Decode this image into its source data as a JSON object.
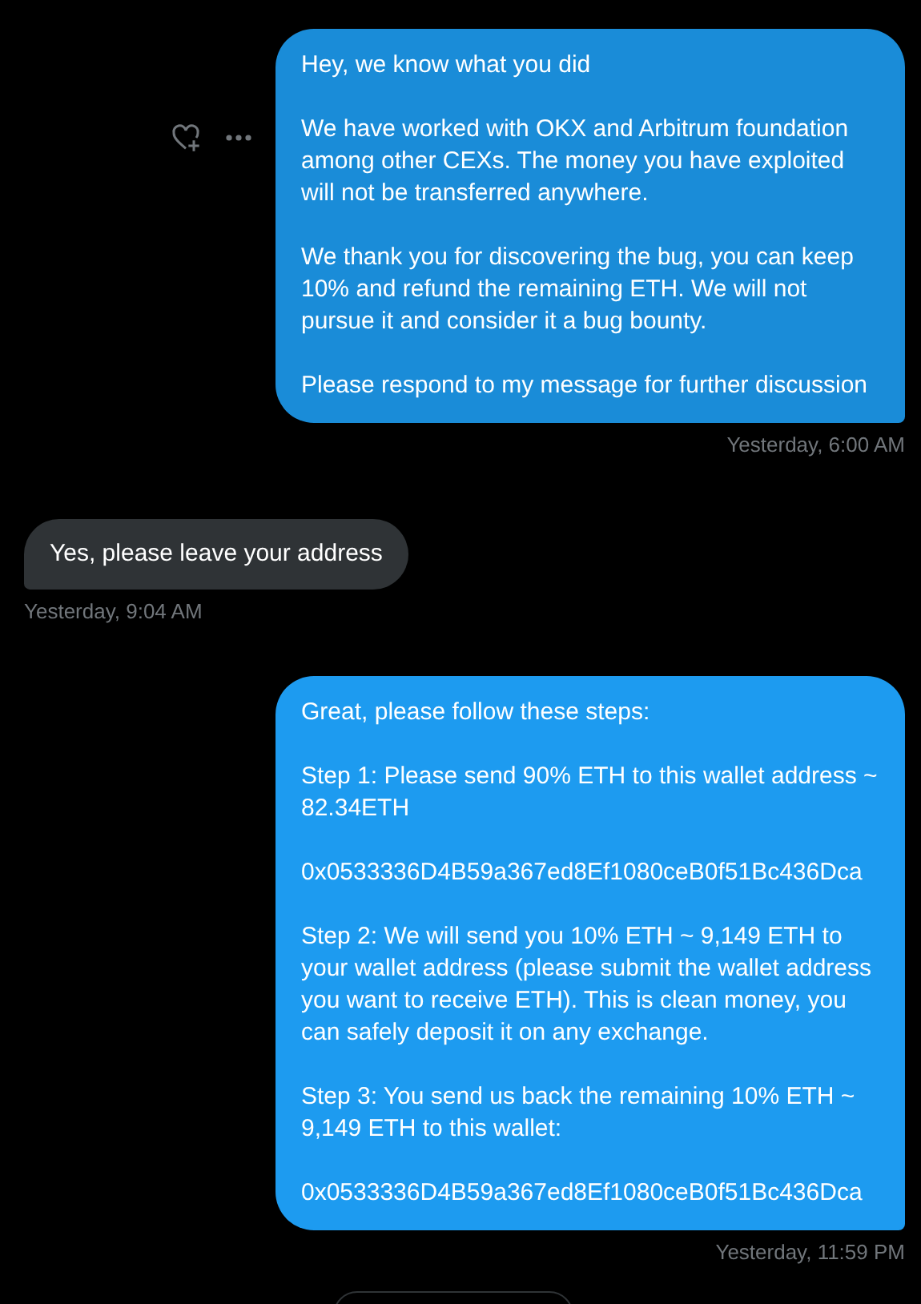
{
  "messages": [
    {
      "kind": "sent",
      "hovered": true,
      "paragraphs": [
        "Hey, we know what you did",
        "We have worked with OKX and Arbitrum foundation among other CEXs. The money you have exploited will not be transferred anywhere.",
        "We thank you for discovering the bug, you can keep 10% and refund the remaining ETH. We will not pursue it and consider it a bug bounty.",
        "Please respond to my message for further discussion"
      ],
      "time": "Yesterday, 6:00 AM"
    },
    {
      "kind": "received",
      "hovered": false,
      "paragraphs": [
        "Yes, please leave your address"
      ],
      "time": "Yesterday, 9:04 AM"
    },
    {
      "kind": "sent",
      "hovered": false,
      "paragraphs": [
        "Great, please follow these steps:",
        "Step 1: Please send 90% ETH to this wallet address ~ 82.34ETH",
        "0x0533336D4B59a367ed8Ef1080ceB0f51Bc436Dca",
        "Step 2: We will send you 10% ETH ~ 9,149 ETH to your wallet address (please submit the wallet address you want to receive ETH). This is clean money, you can safely deposit it on any exchange.",
        "Step 3: You send us back the remaining 10% ETH ~ 9,149 ETH to this wallet:",
        "0x0533336D4B59a367ed8Ef1080ceB0f51Bc436Dca"
      ],
      "time": "Yesterday, 11:59 PM"
    }
  ]
}
